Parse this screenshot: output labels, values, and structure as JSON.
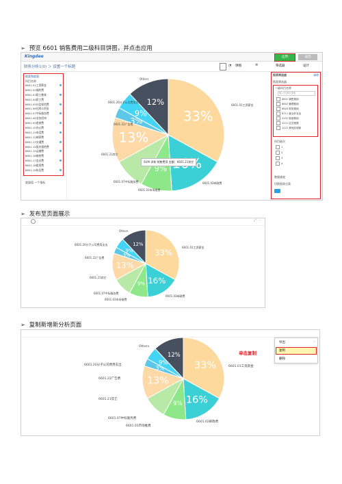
{
  "steps": [
    {
      "bullet": "➢",
      "text": "预览 6601 销售费用二级科目饼图，并点击应用"
    },
    {
      "bullet": "➢",
      "text": "发布至页面展示"
    },
    {
      "bullet": "➢",
      "text": "复制新增新分析页面"
    }
  ],
  "shot1": {
    "logo": "Kingdee",
    "breadcrumb": "财务分析1(0) ＞ 设置一个标题",
    "chart_type_select": "饼图",
    "btn_apply": "应用",
    "btn_cancel": "返回",
    "tab_filter": "筛选器",
    "tab_design": "设计",
    "left_panel_title": "维度和度量",
    "left_group": "科目名称",
    "left_fields": [
      "6601.01工资薪金",
      "6601.02福利费",
      "6601.03职工教育",
      "6601.04职工费",
      "6601.05社会保险费",
      "6601.06住房公积金",
      "6601.07中标服务费",
      "6601.08业务招待",
      "6601.09差旅费",
      "6601.10办公费",
      "6601.11电话费",
      "6601.12邮寄费",
      "6601.13交通费",
      "6601.14报关报检费",
      "6601.15运输费",
      "6601.16维修费",
      "6601.17会议费",
      "6601.18租赁费",
      "6601.19折旧费"
    ],
    "left_footer": "度量值 一个指标",
    "right_title": "报表筛选器",
    "right_clear": "清除",
    "right_sub": "图表筛选器",
    "right_group": "一级科目名称",
    "right_search": "输入关键字搜索",
    "right_items": [
      "6601 销售费用",
      "6602 管理费用",
      "6603 财务费用",
      "6711 营业外支出",
      "5101 制造费用",
      "2221 应交税费",
      "1221 其他应收款"
    ],
    "right_section2": "科目级次",
    "right_levels": [
      "1",
      "2",
      "3",
      "4"
    ],
    "right_section3": "数据维度",
    "right_footer": "切换图表分类",
    "tooltip": "SUM 求和 销售费用 金额：6601.21其它"
  },
  "pie_labels": {
    "others": "Others",
    "l01": "6601.01工资薪金",
    "l02": "6601.02邮政费",
    "l03": "6601.03市场推费",
    "l07": "6601.07中标服务费",
    "l21": "6601.21其它",
    "l22": "6601.22广告费",
    "l20": "6601.20分子公司费用支出"
  },
  "shot3": {
    "menu": [
      "导出",
      "复制",
      "删除"
    ],
    "menu_arrow": "›",
    "annotation": "单击复制"
  },
  "chart_data": {
    "type": "pie",
    "categories": [
      "6601.01工资薪金",
      "6601.02邮政费",
      "6601.03市场推费",
      "6601.07中标服务费",
      "6601.21其它",
      "6601.22广告费",
      "6601.20分子公司费用支出",
      "Others"
    ],
    "values": [
      33,
      16,
      9,
      9,
      13,
      3,
      5,
      12
    ],
    "percent_labels": [
      "33%",
      "16%",
      "9%",
      "",
      "13%",
      "3%",
      "9%",
      "12%"
    ],
    "colors": [
      "#fdd99e",
      "#3ad0d6",
      "#8ee88a",
      "#b8e9a6",
      "#fdd9a8",
      "#5cc7e7",
      "#44d4f5",
      "#47505f"
    ]
  }
}
